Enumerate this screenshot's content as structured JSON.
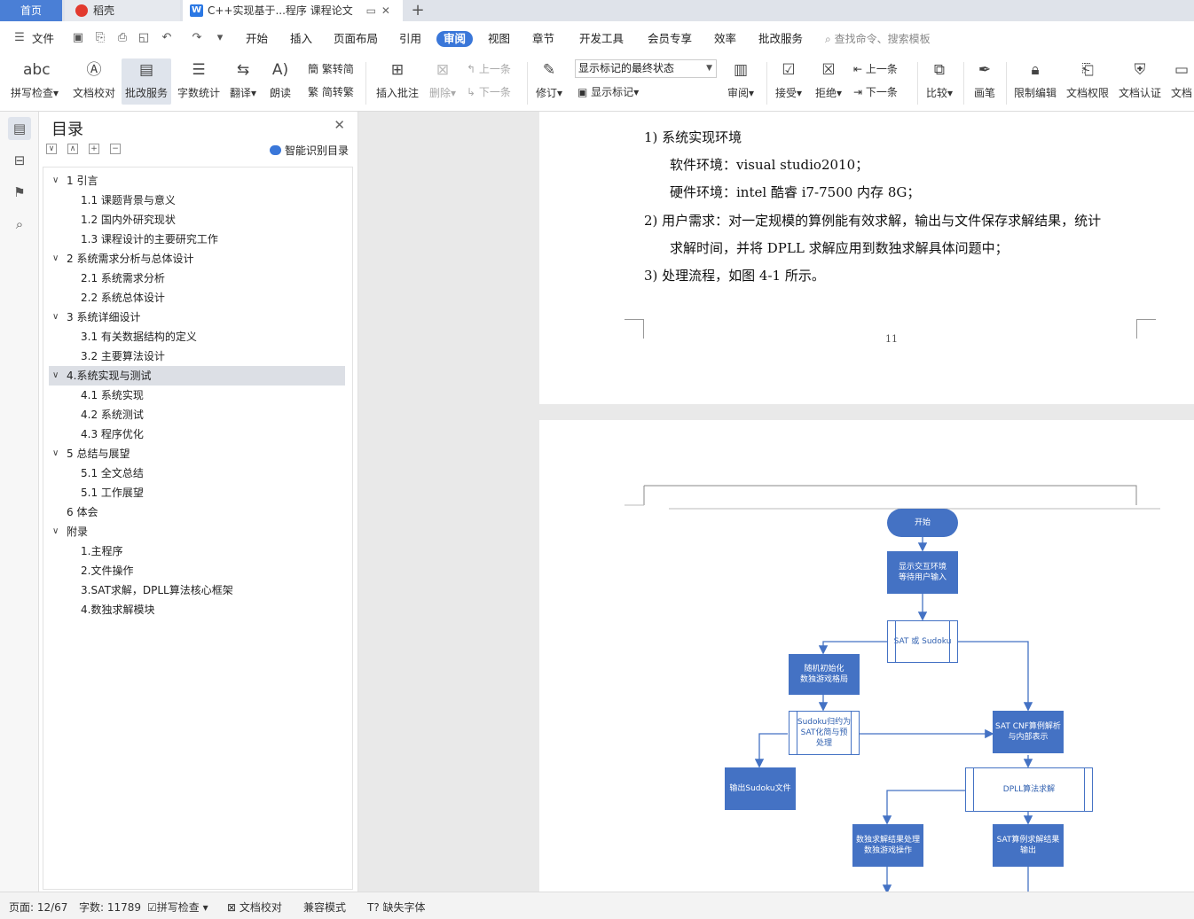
{
  "tabs": {
    "home": "首页",
    "daoke": "稻壳",
    "doc": "C++实现基于...程序 课程论文",
    "add": "+"
  },
  "menu": {
    "file": "文件",
    "items": [
      "开始",
      "插入",
      "页面布局",
      "引用",
      "审阅",
      "视图",
      "章节",
      "开发工具",
      "会员专享",
      "效率",
      "批改服务"
    ],
    "active": "审阅",
    "search": "查找命令、搜索模板"
  },
  "ribbon": {
    "spell": "拼写检查",
    "doccheck": "文档校对",
    "review_service": "批改服务",
    "wordcount": "字数统计",
    "translate": "翻译",
    "read": "朗读",
    "t2s": "繁转简",
    "s2t": "简转繁",
    "insert_comment": "插入批注",
    "delete": "删除",
    "prev": "上一条",
    "next": "下一条",
    "revise": "修订",
    "markup_state": "显示标记的最终状态",
    "show_markup": "显示标记",
    "review": "审阅",
    "accept": "接受",
    "reject": "拒绝",
    "prev2": "上一条",
    "next2": "下一条",
    "compare": "比较",
    "pen": "画笔",
    "restrict": "限制编辑",
    "permission": "文档权限",
    "certify": "文档认证",
    "more": "文档"
  },
  "toc": {
    "title": "目录",
    "smart": "智能识别目录",
    "items": [
      {
        "text": "1 引言",
        "level": 1,
        "chev": "∨"
      },
      {
        "text": "1.1  课题背景与意义",
        "level": 2
      },
      {
        "text": "1.2  国内外研究现状",
        "level": 2
      },
      {
        "text": "1.3  课程设计的主要研究工作",
        "level": 2
      },
      {
        "text": "2  系统需求分析与总体设计",
        "level": 1,
        "chev": "∨"
      },
      {
        "text": "2.1    系统需求分析",
        "level": 2
      },
      {
        "text": "2.2  系统总体设计",
        "level": 2
      },
      {
        "text": "3  系统详细设计",
        "level": 1,
        "chev": "∨"
      },
      {
        "text": "3.1    有关数据结构的定义",
        "level": 2
      },
      {
        "text": "3.2    主要算法设计",
        "level": 2
      },
      {
        "text": "4.系统实现与测试",
        "level": 1,
        "chev": "∨",
        "selected": true
      },
      {
        "text": "4.1  系统实现",
        "level": 2
      },
      {
        "text": "4.2  系统测试",
        "level": 2
      },
      {
        "text": "4.3 程序优化",
        "level": 2
      },
      {
        "text": "5  总结与展望",
        "level": 1,
        "chev": "∨"
      },
      {
        "text": "5.1  全文总结",
        "level": 2
      },
      {
        "text": "5.1  工作展望",
        "level": 2
      },
      {
        "text": "6 体会",
        "level": 1
      },
      {
        "text": "附录",
        "level": 1,
        "chev": "∨"
      },
      {
        "text": "1.主程序",
        "level": 2
      },
      {
        "text": "2.文件操作",
        "level": 2
      },
      {
        "text": "3.SAT求解，DPLL算法核心框架",
        "level": 2
      },
      {
        "text": "4.数独求解模块",
        "level": 2
      }
    ]
  },
  "doc": {
    "p1": "1)    系统实现环境",
    "p2": "软件环境：visual studio2010；",
    "p3": "硬件环境：intel 酷睿 i7-7500  内存 8G；",
    "p4": "2)    用户需求：对一定规模的算例能有效求解，输出与文件保存求解结果，统计",
    "p5": "求解时间，并将 DPLL 求解应用到数独求解具体问题中；",
    "p6": "3)    处理流程，如图  4-1  所示。",
    "page_number": "11"
  },
  "flow": {
    "start": "开始",
    "show": "显示交互环境\n等待用户输入",
    "choice": "SAT 或 Sudoku",
    "init": "随机初始化\n数独游戏格局",
    "reduce": "Sudoku归约为\nSAT化简与预\n处理",
    "parse": "SAT CNF算例解析\n与内部表示",
    "out_sudoku": "输出Sudoku文件",
    "dpll": "DPLL算法求解",
    "sudoku_proc": "数独求解结果处理\n数独游戏操作",
    "sat_out": "SAT算例求解结果\n输出"
  },
  "status": {
    "page": "页面: 12/67",
    "words": "字数: 11789",
    "spell": "拼写检查",
    "check": "文档校对",
    "compat": "兼容模式",
    "font": "缺失字体"
  }
}
